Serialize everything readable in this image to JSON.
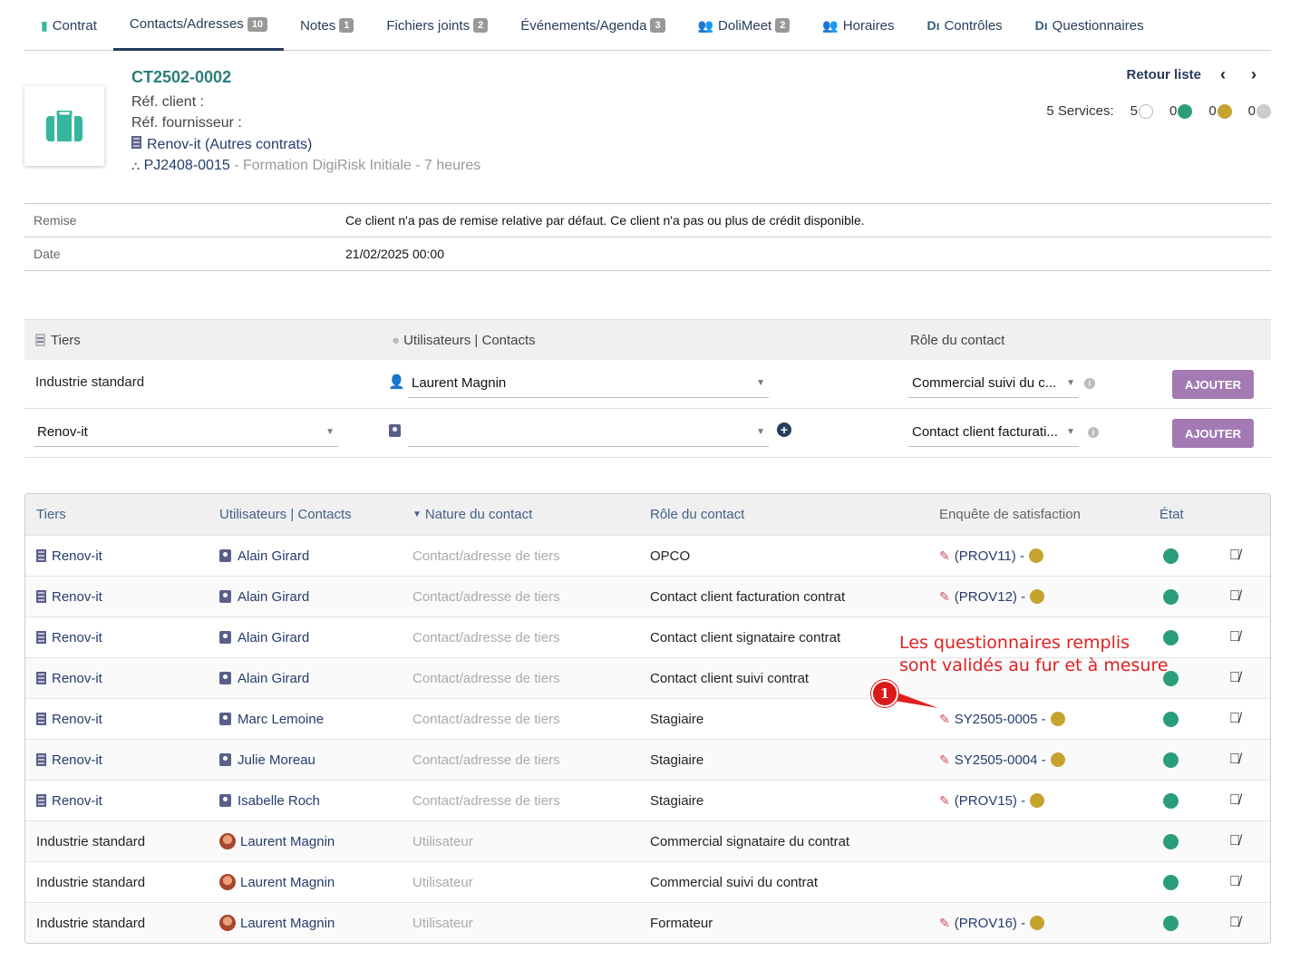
{
  "tabs": [
    {
      "label": "Contrat",
      "badge": "",
      "icon": "briefcase-icon"
    },
    {
      "label": "Contacts/Adresses",
      "badge": "10",
      "icon": ""
    },
    {
      "label": "Notes",
      "badge": "1",
      "icon": ""
    },
    {
      "label": "Fichiers joints",
      "badge": "2",
      "icon": ""
    },
    {
      "label": "Événements/Agenda",
      "badge": "3",
      "icon": ""
    },
    {
      "label": "DoliMeet",
      "badge": "2",
      "icon": "people-icon"
    },
    {
      "label": "Horaires",
      "badge": "",
      "icon": "people-icon"
    },
    {
      "label": "Contrôles",
      "badge": "",
      "icon": "digirisk-icon"
    },
    {
      "label": "Questionnaires",
      "badge": "",
      "icon": "digirisk-icon"
    }
  ],
  "header": {
    "ref": "CT2502-0002",
    "ref_client": "Réf. client :",
    "ref_fournisseur": "Réf. fournisseur :",
    "thirdparty": "Renov-it",
    "thirdparty_type": "(Autres contrats)",
    "project_ref": "PJ2408-0015",
    "project_label": "- Formation DigiRisk Initiale - 7 heures",
    "retour_liste": "Retour liste",
    "services_label": "5 Services:",
    "services_counts": [
      "5",
      "0",
      "0",
      "0"
    ]
  },
  "fields": [
    {
      "label": "Remise",
      "value": "Ce client n'a pas de remise relative par défaut. Ce client n'a pas ou plus de crédit disponible."
    },
    {
      "label": "Date",
      "value": "21/02/2025 00:00"
    }
  ],
  "form": {
    "headers": {
      "tiers": "Tiers",
      "users": "Utilisateurs | Contacts",
      "role": "Rôle du contact"
    },
    "row1": {
      "tiers": "Industrie standard",
      "user": "Laurent Magnin",
      "role": "Commercial suivi du c...",
      "button": "AJOUTER"
    },
    "row2": {
      "tiers": "Renov-it",
      "user": "",
      "role": "Contact client facturati...",
      "button": "AJOUTER"
    }
  },
  "list": {
    "headers": [
      "Tiers",
      "Utilisateurs | Contacts",
      "Nature du contact",
      "Rôle du contact",
      "Enquête de satisfaction",
      "État"
    ],
    "rows": [
      {
        "tiers": "Renov-it",
        "user": "Alain Girard",
        "nature": "Contact/adresse de tiers",
        "role": "OPCO",
        "enquete": "(PROV11) -",
        "kind": "contact"
      },
      {
        "tiers": "Renov-it",
        "user": "Alain Girard",
        "nature": "Contact/adresse de tiers",
        "role": "Contact client facturation contrat",
        "enquete": "(PROV12) -",
        "kind": "contact"
      },
      {
        "tiers": "Renov-it",
        "user": "Alain Girard",
        "nature": "Contact/adresse de tiers",
        "role": "Contact client signataire contrat",
        "enquete": "",
        "kind": "contact"
      },
      {
        "tiers": "Renov-it",
        "user": "Alain Girard",
        "nature": "Contact/adresse de tiers",
        "role": "Contact client suivi contrat",
        "enquete": "",
        "kind": "contact"
      },
      {
        "tiers": "Renov-it",
        "user": "Marc Lemoine",
        "nature": "Contact/adresse de tiers",
        "role": "Stagiaire",
        "enquete": "SY2505-0005 -",
        "kind": "contact"
      },
      {
        "tiers": "Renov-it",
        "user": "Julie Moreau",
        "nature": "Contact/adresse de tiers",
        "role": "Stagiaire",
        "enquete": "SY2505-0004 -",
        "kind": "contact"
      },
      {
        "tiers": "Renov-it",
        "user": "Isabelle Roch",
        "nature": "Contact/adresse de tiers",
        "role": "Stagiaire",
        "enquete": "(PROV15) -",
        "kind": "contact"
      },
      {
        "tiers": "Industrie standard",
        "user": "Laurent Magnin",
        "nature": "Utilisateur",
        "role": "Commercial signataire du contrat",
        "enquete": "",
        "kind": "user"
      },
      {
        "tiers": "Industrie standard",
        "user": "Laurent Magnin",
        "nature": "Utilisateur",
        "role": "Commercial suivi du contrat",
        "enquete": "",
        "kind": "user"
      },
      {
        "tiers": "Industrie standard",
        "user": "Laurent Magnin",
        "nature": "Utilisateur",
        "role": "Formateur",
        "enquete": "(PROV16) -",
        "kind": "user"
      }
    ]
  },
  "annotation": {
    "line1": "Les questionnaires remplis",
    "line2": "sont validés au fur et à mesure",
    "marker": "1"
  },
  "colors": {
    "accent": "#263c5c",
    "teal": "#36b5a0",
    "status_green": "#2a9d7c",
    "survey_gold": "#c6a32e",
    "button": "#a37ab3",
    "annotation": "#e02020"
  }
}
